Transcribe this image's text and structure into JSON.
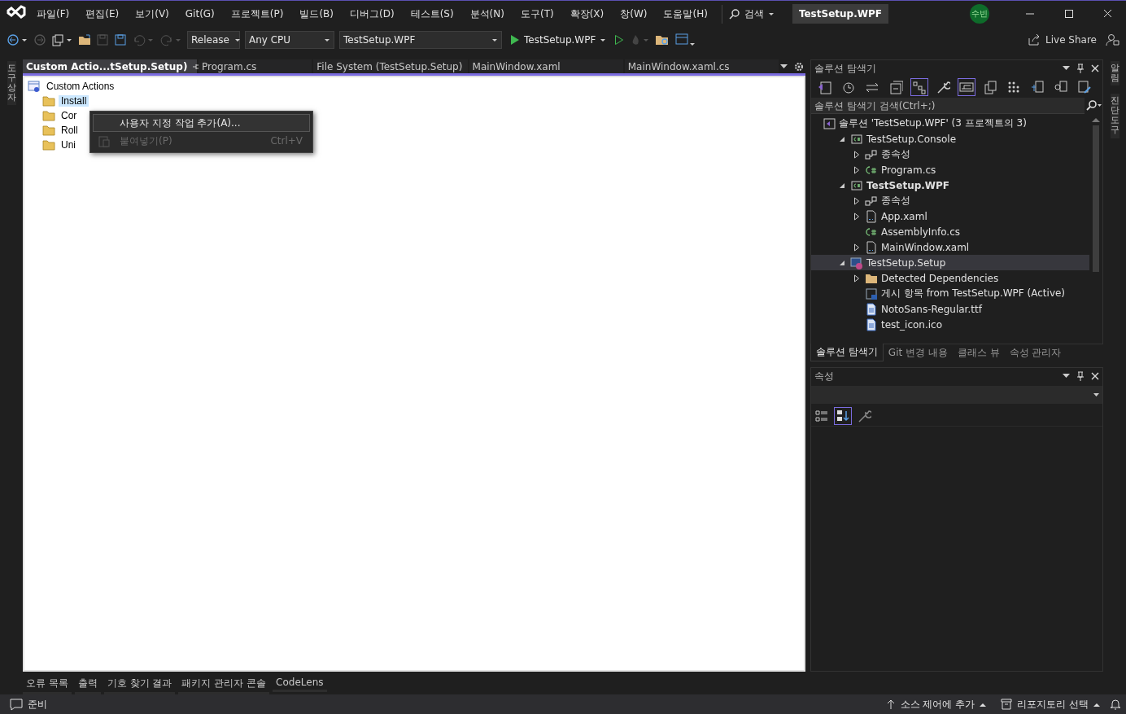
{
  "title_bar": {
    "menu": [
      "파일(F)",
      "편집(E)",
      "보기(V)",
      "Git(G)",
      "프로젝트(P)",
      "빌드(B)",
      "디버그(D)",
      "테스트(S)",
      "분석(N)",
      "도구(T)",
      "확장(X)",
      "창(W)",
      "도움말(H)"
    ],
    "search": "검색",
    "solution_name": "TestSetup.WPF",
    "account": "수빈"
  },
  "toolbar": {
    "configuration": "Release",
    "platform": "Any CPU",
    "startup_project": "TestSetup.WPF",
    "run_target": "TestSetup.WPF",
    "live_share": "Live Share"
  },
  "left_strip": [
    "도구 상자"
  ],
  "right_strip": [
    "알림",
    "진단 도구"
  ],
  "document_tabs": [
    {
      "label": "Custom Actio...tSetup.Setup)",
      "selected": true
    },
    {
      "label": "Program.cs",
      "selected": false
    },
    {
      "label": "File System (TestSetup.Setup)",
      "selected": false
    },
    {
      "label": "MainWindow.xaml",
      "selected": false
    },
    {
      "label": "MainWindow.xaml.cs",
      "selected": false
    }
  ],
  "designer": {
    "root": "Custom Actions",
    "items": [
      {
        "label": "Install",
        "selected": true
      },
      {
        "label": "Cor",
        "selected": false
      },
      {
        "label": "Roll",
        "selected": false
      },
      {
        "label": "Uni",
        "selected": false
      }
    ]
  },
  "context_menu": [
    {
      "label": "사용자 지정 작업 추가(A)...",
      "selected": true,
      "disabled": false
    },
    {
      "label": "붙여넣기(P)",
      "shortcut": "Ctrl+V",
      "selected": false,
      "disabled": true
    }
  ],
  "solution_explorer": {
    "title": "솔루션 탐색기",
    "search_placeholder": "솔루션 탐색기 검색(Ctrl+;)",
    "tree": [
      {
        "label": "솔루션 'TestSetup.WPF'   (3 프로젝트의 3)",
        "kind": "solution",
        "selected": false,
        "startup": false,
        "children": [
          {
            "label": "TestSetup.Console",
            "kind": "csproj",
            "expanded": true,
            "selected": false,
            "startup": false,
            "children": [
              {
                "label": "종속성",
                "kind": "dependencies",
                "expanded": false,
                "selected": false,
                "startup": false
              },
              {
                "label": "Program.cs",
                "kind": "csharp",
                "expanded": false,
                "selected": false,
                "startup": false
              }
            ]
          },
          {
            "label": "TestSetup.WPF",
            "kind": "csproj",
            "expanded": true,
            "selected": false,
            "startup": true,
            "children": [
              {
                "label": "종속성",
                "kind": "dependencies",
                "expanded": false,
                "selected": false,
                "startup": false
              },
              {
                "label": "App.xaml",
                "kind": "xaml",
                "expanded": false,
                "selected": false,
                "startup": false
              },
              {
                "label": "AssemblyInfo.cs",
                "kind": "csharp",
                "selected": false,
                "startup": false
              },
              {
                "label": "MainWindow.xaml",
                "kind": "xaml",
                "expanded": false,
                "selected": false,
                "startup": false
              }
            ]
          },
          {
            "label": "TestSetup.Setup",
            "kind": "setup",
            "expanded": true,
            "selected": true,
            "startup": false,
            "children": [
              {
                "label": "Detected Dependencies",
                "kind": "folder",
                "expanded": false,
                "selected": false,
                "startup": false
              },
              {
                "label": "게시 항목 from TestSetup.WPF (Active)",
                "kind": "publish",
                "selected": false,
                "startup": false
              },
              {
                "label": "NotoSans-Regular.ttf",
                "kind": "file",
                "selected": false,
                "startup": false
              },
              {
                "label": "test_icon.ico",
                "kind": "file",
                "selected": false,
                "startup": false
              }
            ]
          }
        ]
      }
    ],
    "tabs": [
      {
        "label": "솔루션 탐색기",
        "selected": true
      },
      {
        "label": "Git 변경 내용",
        "selected": false
      },
      {
        "label": "클래스 뷰",
        "selected": false
      },
      {
        "label": "속성 관리자",
        "selected": false
      }
    ]
  },
  "properties": {
    "title": "속성"
  },
  "bottom_tabs": [
    "오류 목록",
    "출력",
    "기호 찾기 결과",
    "패키지 관리자 콘솔",
    "CodeLens"
  ],
  "status_bar": {
    "message": "준비",
    "source_control": "소스 제어에 추가",
    "repository": "리포지토리 선택"
  }
}
